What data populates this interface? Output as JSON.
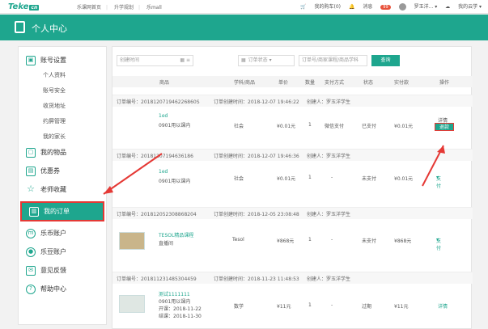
{
  "topbar": {
    "logo": "Teke",
    "logo_cn": "cn",
    "links": [
      "乐课网首页",
      "升学规划",
      "乐mall"
    ],
    "cart": "我的购车(0)",
    "message": "消息",
    "message_count": "99",
    "user": "罗玉洋...",
    "cloud": "我的云学"
  },
  "header": {
    "title": "个人中心"
  },
  "sidebar": {
    "account": "账号设置",
    "account_items": [
      "个人资料",
      "账号安全",
      "收货地址",
      "约屏管理",
      "我的家长"
    ],
    "goods": "我的物品",
    "coupon": "优惠券",
    "favorites": "老师收藏",
    "orders": "我的订单",
    "lecoin": "乐币账户",
    "ledou": "乐豆账户",
    "feedback": "意见反馈",
    "help": "帮助中心"
  },
  "filter": {
    "date_label": "创建时间",
    "status_label": "订单状态",
    "search_placeholder": "订单号/商家课程/商品学科",
    "search_button": "查询"
  },
  "columns": [
    "商品",
    "学科/商品",
    "单价",
    "数量",
    "支付方式",
    "状态",
    "实付款",
    "操作"
  ],
  "orders": [
    {
      "no": "订单编号：201812071946226860S",
      "created": "订单创建时间：2018-12-07 19:46:22",
      "creator": "创建人：罗玉洋学生",
      "name": "1ed",
      "sub": "0901用以课内",
      "subject": "社会",
      "price": "¥0.01元",
      "qty": "1",
      "pay": "微信支付",
      "status": "已支付",
      "paid": "¥0.01元",
      "action": "详情",
      "refund": "退款"
    },
    {
      "no": "订单编号：20181207194636186",
      "created": "订单创建时间：2018-12-07 19:46:36",
      "creator": "创建人：罗玉洋学生",
      "name": "1ed",
      "sub": "0901用以课内",
      "subject": "社会",
      "price": "¥0.01元",
      "qty": "1",
      "pay": "-",
      "status": "未支付",
      "paid": "¥0.01元",
      "action": "支付"
    },
    {
      "no": "订单编号：201812052308868204",
      "created": "订单创建时间：2018-12-05 23:08:48",
      "creator": "创建人：罗玉洋学生",
      "name": "TESOL精品课程",
      "sub": "直播间",
      "subject": "Tesol",
      "price": "¥868元",
      "qty": "1",
      "pay": "-",
      "status": "未支付",
      "paid": "¥868元",
      "action": "支付"
    },
    {
      "no": "订单编号：201811231485304459",
      "created": "订单创建时间：2018-11-23 11:48:53",
      "creator": "创建人：罗玉洋学生",
      "name": "测试1111111",
      "sub": "0901用以课内",
      "open": "开课：2018-11-22",
      "end": "结课：2018-11-30",
      "subject": "数学",
      "price": "¥11元",
      "qty": "1",
      "pay": "-",
      "status": "过期",
      "paid": "¥11元",
      "action": "详情"
    }
  ],
  "colors": {
    "accent": "#1ea68e",
    "highlight": "#e53935"
  }
}
